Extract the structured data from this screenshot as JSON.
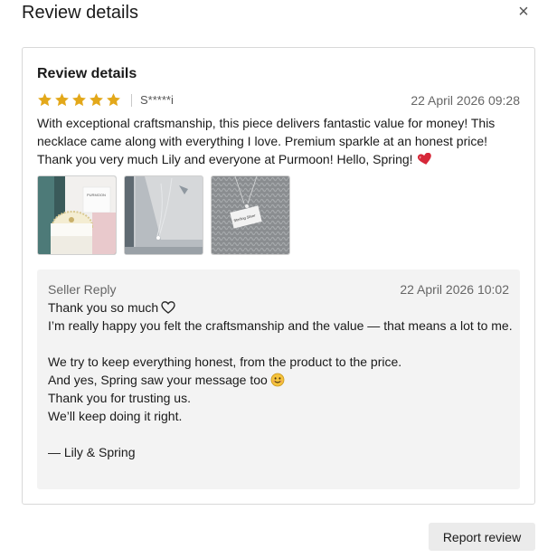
{
  "modal": {
    "title": "Review details",
    "close_symbol": "×"
  },
  "review": {
    "title": "Review details",
    "rating": 5,
    "max_rating": 5,
    "star_color": "#e3a81a",
    "reviewer": "S*****i",
    "date": "22 April 2026 09:28",
    "text": "With exceptional craftsmanship, this piece delivers fantastic value for money! This necklace came along with everything I love. Premium sparkle at an honest price! Thank you very much Lily and everyone at Purmoon! Hello, Spring!",
    "text_emoji": "red-heart-icon",
    "photos": [
      {
        "icon": "jewelry-box-photo"
      },
      {
        "icon": "necklace-on-neck-photo"
      },
      {
        "icon": "pendant-on-knit-photo"
      }
    ]
  },
  "seller_reply": {
    "label": "Seller Reply",
    "date": "22 April 2026 10:02",
    "lines": [
      "Thank you so much",
      "I’m really happy you felt the craftsmanship and the value — that means a lot to me.",
      "",
      "We try to keep everything honest, from the product to the price.",
      "And yes, Spring saw your message too",
      "Thank you for trusting us.",
      "We’ll keep doing it right.",
      "",
      "— Lily & Spring"
    ]
  },
  "actions": {
    "report_label": "Report review"
  }
}
